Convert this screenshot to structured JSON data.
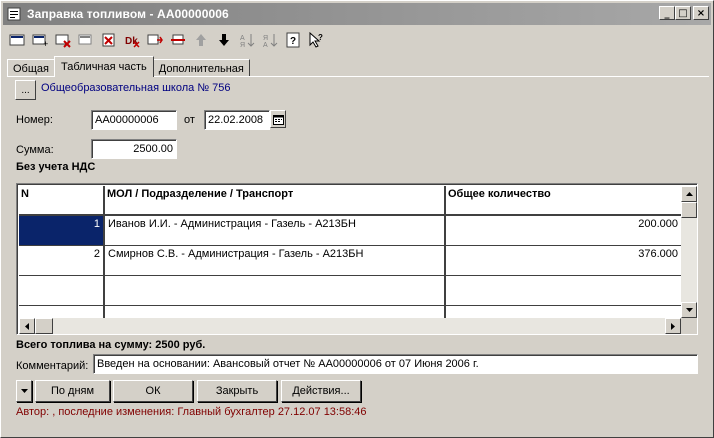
{
  "window": {
    "title": "Заправка топливом - АА00000006",
    "min_glyph": "_",
    "max_glyph": "□",
    "close_glyph": "×"
  },
  "tabs": [
    {
      "label": "Общая"
    },
    {
      "label": "Табличная часть"
    },
    {
      "label": "Дополнительная"
    }
  ],
  "header": {
    "org_button_label": "...",
    "org_name": "Общеобразовательная школа № 756",
    "number_label": "Номер:",
    "number_value": "АА00000006",
    "date_label": "от",
    "date_value": "22.02.2008",
    "sum_label": "Сумма:",
    "sum_value": "2500.00",
    "vat_note": "Без учета НДС"
  },
  "table": {
    "columns": [
      "N",
      "МОЛ / Подразделение / Транспорт",
      "Общее количество"
    ],
    "rows": [
      {
        "n": "1",
        "mol": "Иванов И.И. - Администрация - Газель - А213БН",
        "qty": "200.000"
      },
      {
        "n": "2",
        "mol": "Смирнов С.В. - Администрация - Газель - А213БН",
        "qty": "376.000"
      },
      {
        "n": "",
        "mol": "",
        "qty": ""
      },
      {
        "n": "",
        "mol": "",
        "qty": ""
      }
    ]
  },
  "footer": {
    "total_text": "Всего топлива на сумму: 2500 руб.",
    "comment_label": "Комментарий:",
    "comment_value": "Введен на основании: Авансовый отчет № АА00000006 от 07 Июня 2006 г.",
    "btn_by_days": "По дням",
    "btn_ok": "ОК",
    "btn_close": "Закрыть",
    "btn_actions": "Действия...",
    "status": "Автор: , последние изменения: Главный бухгалтер 27.12.07 13:58:46"
  },
  "colors": {
    "selection": "#0a246a",
    "link": "#000080",
    "status": "#800000"
  }
}
